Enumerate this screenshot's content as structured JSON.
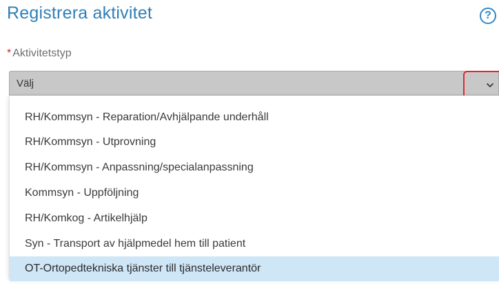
{
  "dialog": {
    "title": "Registrera aktivitet",
    "help_symbol": "?"
  },
  "field": {
    "required_marker": "*",
    "label": "Aktivitetstyp",
    "selected_value": "Välj"
  },
  "dropdown": {
    "options": [
      {
        "label": "RH/Kommsyn - Reparation/Avhjälpande underhåll",
        "highlighted": false
      },
      {
        "label": "RH/Kommsyn - Utprovning",
        "highlighted": false
      },
      {
        "label": "RH/Kommsyn - Anpassning/specialanpassning",
        "highlighted": false
      },
      {
        "label": "Kommsyn - Uppföljning",
        "highlighted": false
      },
      {
        "label": "RH/Komkog - Artikelhjälp",
        "highlighted": false
      },
      {
        "label": "Syn - Transport av hjälpmedel hem till patient",
        "highlighted": false
      },
      {
        "label": "OT-Ortopedtekniska tjänster till tjänsteleverantör",
        "highlighted": true
      }
    ]
  },
  "colors": {
    "title": "#2f7fb6",
    "required": "#d62020",
    "select_bg": "#c8c8c8",
    "highlight_option": "#cfe6f7",
    "annotation_outline": "#e0282e"
  },
  "icons": {
    "help": "help-circle-icon",
    "dropdown_toggle": "chevron-down-icon"
  }
}
